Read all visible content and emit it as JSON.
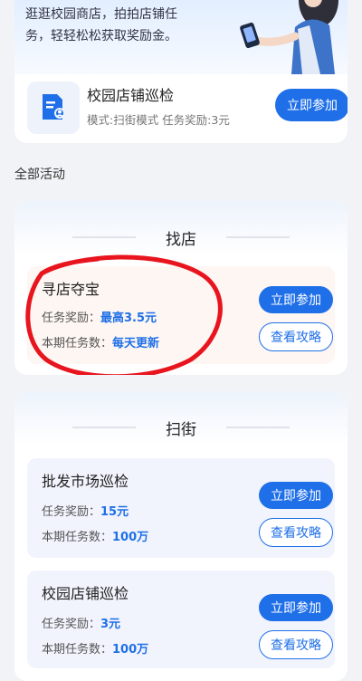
{
  "top": {
    "hero_text_line1": "逛逛校园商店，拍拍店铺任",
    "hero_text_line2": "务，轻轻松松获取奖励金。",
    "task": {
      "title": "校园店铺巡检",
      "subtitle": "模式:扫街模式 任务奖励:3元",
      "join_label": "立即参加"
    }
  },
  "section_label": "全部活动",
  "groups": [
    {
      "title": "找店",
      "items": [
        {
          "title": "寻店夺宝",
          "reward_label": "任务奖励：",
          "reward_value": "最高3.5元",
          "count_label": "本期任务数：",
          "count_value": "每天更新",
          "join_label": "立即参加",
          "guide_label": "查看攻略"
        }
      ]
    },
    {
      "title": "扫街",
      "items": [
        {
          "title": "批发市场巡检",
          "reward_label": "任务奖励：",
          "reward_value": "15元",
          "count_label": "本期任务数：",
          "count_value": "100万",
          "join_label": "立即参加",
          "guide_label": "查看攻略"
        },
        {
          "title": "校园店铺巡检",
          "reward_label": "任务奖励：",
          "reward_value": "3元",
          "count_label": "本期任务数：",
          "count_value": "100万",
          "join_label": "立即参加",
          "guide_label": "查看攻略"
        }
      ]
    }
  ],
  "colors": {
    "accent": "#1f6fe8",
    "highlight_circle": "#e8141e",
    "page_bg": "#f2f3f6"
  }
}
